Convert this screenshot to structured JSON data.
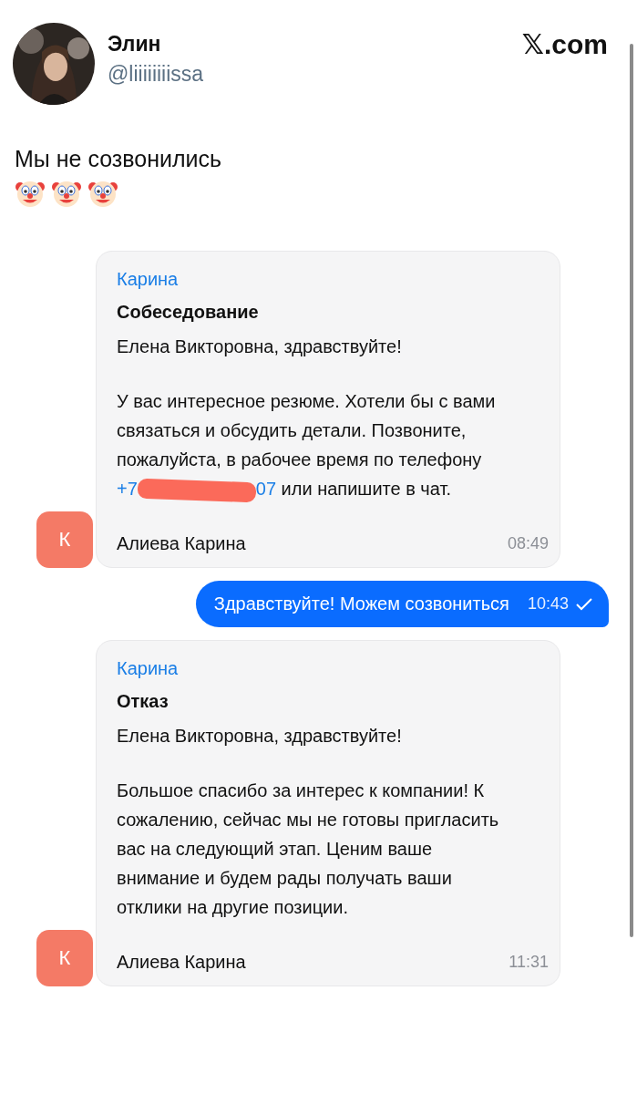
{
  "author": {
    "name": "Элин",
    "handle": "@liiiiiiiissa"
  },
  "brand": "𝕏.com",
  "tweet": {
    "text": "Мы не созвонились",
    "emojis": [
      {
        "kind": "clown"
      },
      {
        "kind": "clown"
      },
      {
        "kind": "clown"
      }
    ]
  },
  "messages": [
    {
      "kind": "incoming",
      "sender": "Карина",
      "subject": "Собеседование",
      "paragraphs": [
        "Елена Викторовна, здравствуйте!",
        "У вас интересное резюме. Хотели бы с вами связаться и обсудить детали. Позвоните, пожалуйста, в рабочее время по телефону "
      ],
      "phone_start": "+7",
      "phone_end": "07",
      "after_phone": " или напишите в чат.",
      "signature": "Алиева Карина",
      "time": "08:49",
      "avatar_letter": "К"
    },
    {
      "kind": "outgoing",
      "text": "Здравствуйте! Можем созвониться",
      "time": "10:43",
      "delivered": true
    },
    {
      "kind": "incoming",
      "sender": "Карина",
      "subject": "Отказ",
      "paragraphs": [
        "Елена Викторовна, здравствуйте!",
        "Большое спасибо за интерес к компании! К сожалению, сейчас мы не готовы пригласить вас на следующий этап. Ценим ваше внимание и будем рады получать ваши отклики на другие позиции."
      ],
      "signature": "Алиева Карина",
      "time": "11:31",
      "avatar_letter": "К"
    }
  ]
}
